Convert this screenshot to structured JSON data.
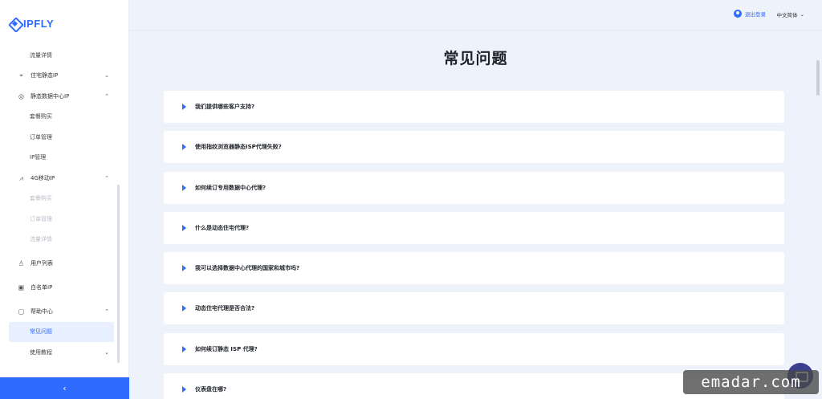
{
  "brand": {
    "name": "IPFLY"
  },
  "sidebar": {
    "items": [
      {
        "label": "流量详情",
        "kind": "sub"
      },
      {
        "label": "住宅静态IP",
        "kind": "parent",
        "icon": "pin-icon",
        "expanded": false
      },
      {
        "label": "静态数据中心IP",
        "kind": "parent",
        "icon": "globe-icon",
        "expanded": true
      },
      {
        "label": "套餐购买",
        "kind": "sub"
      },
      {
        "label": "订单管理",
        "kind": "sub"
      },
      {
        "label": "IP管理",
        "kind": "sub"
      },
      {
        "label": "4G移动IP",
        "kind": "parent",
        "icon": "signal-icon",
        "expanded": true
      },
      {
        "label": "套餐购买",
        "kind": "sub",
        "dim": true
      },
      {
        "label": "订单管理",
        "kind": "sub",
        "dim": true
      },
      {
        "label": "流量详情",
        "kind": "sub",
        "dim": true
      },
      {
        "label": "用户列表",
        "kind": "parent",
        "icon": "user-icon"
      },
      {
        "label": "白名单IP",
        "kind": "parent",
        "icon": "shield-icon"
      },
      {
        "label": "帮助中心",
        "kind": "parent",
        "icon": "help-icon",
        "expanded": true
      },
      {
        "label": "常见问题",
        "kind": "sub",
        "active": true
      },
      {
        "label": "使用教程",
        "kind": "sub",
        "chevron": true
      }
    ],
    "collapse_icon": "‹"
  },
  "header": {
    "user_label": "退出登录",
    "language": "中文简体",
    "language_chevron": "⌄"
  },
  "main": {
    "title": "常见问题",
    "faq": [
      "我们提供哪些客户支持?",
      "使用指纹浏览器静态ISP代理失败?",
      "如何续订专用数据中心代理?",
      "什么是动态住宅代理?",
      "我可以选择数据中心代理的国家和城市吗?",
      "动态住宅代理是否合法?",
      "如何续订静态 ISP 代理?",
      "仪表盘在哪?"
    ]
  },
  "watermark": "emadar.com",
  "colors": {
    "accent": "#2f6bff",
    "background": "#eef3fb"
  }
}
